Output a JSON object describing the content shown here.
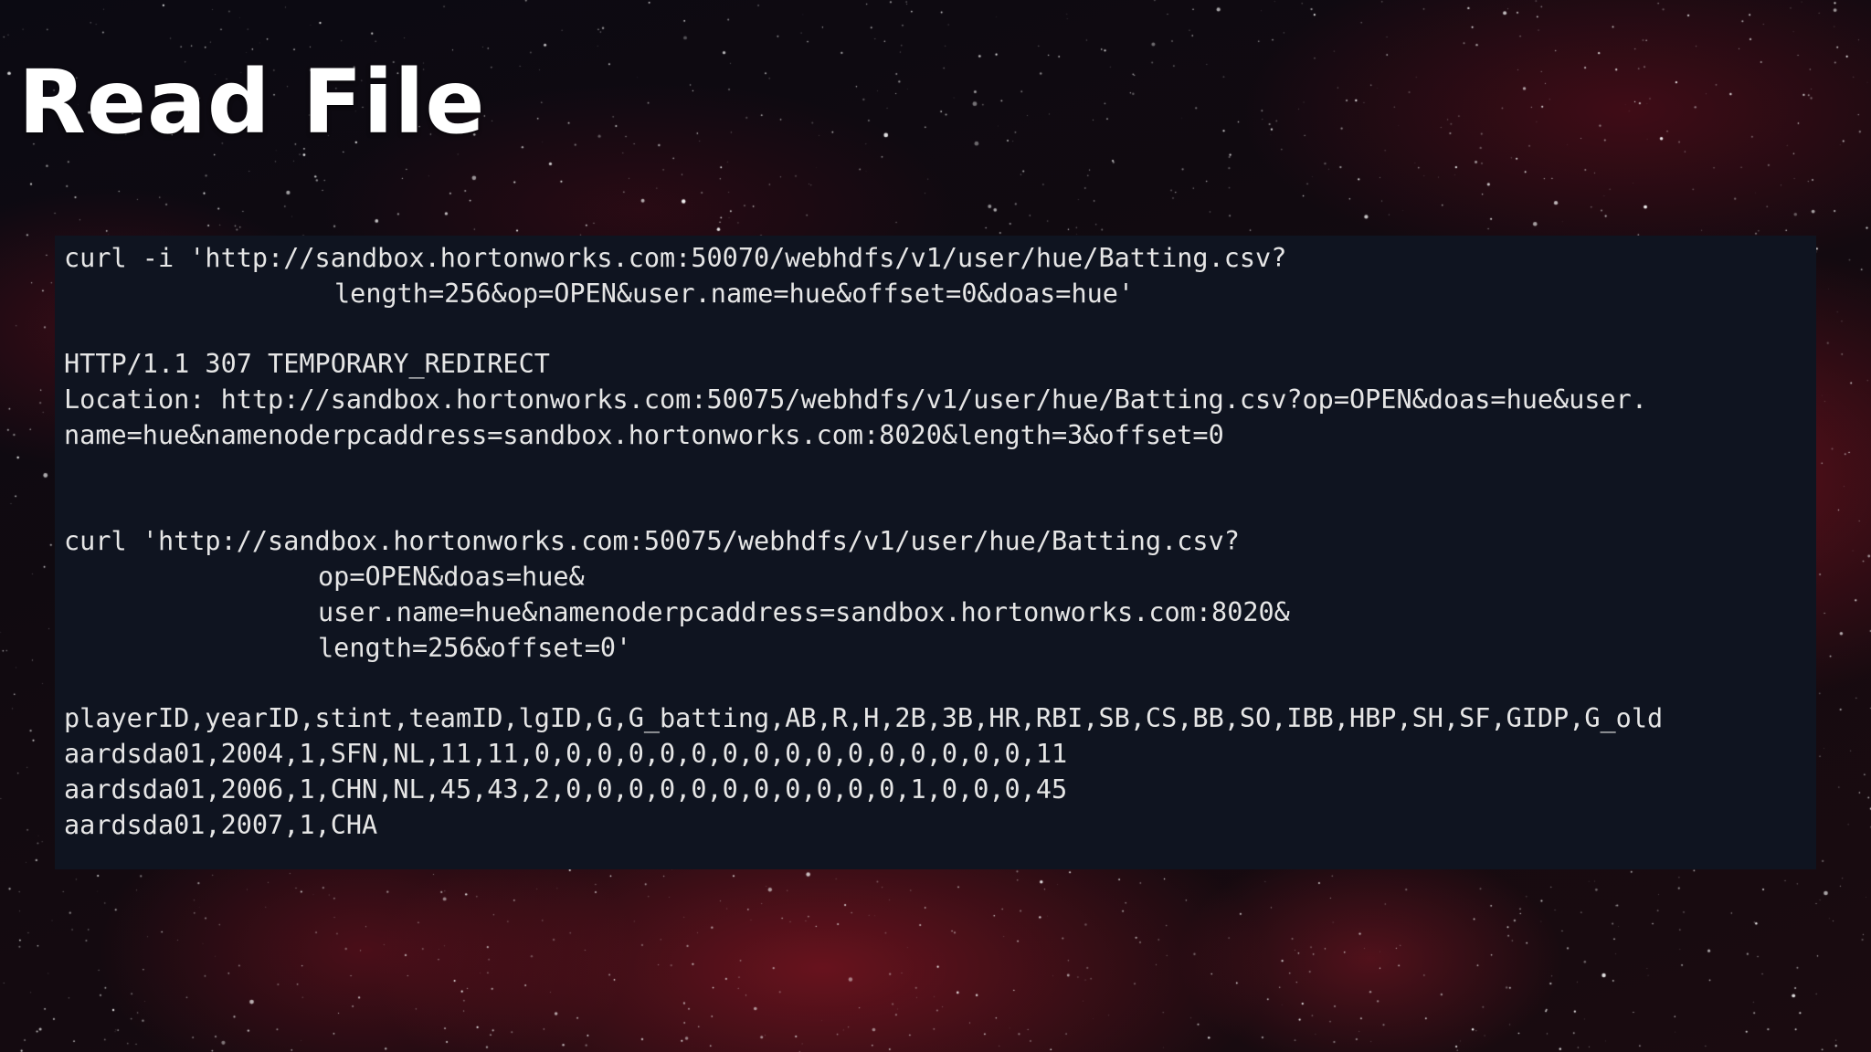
{
  "slide": {
    "title": "Read File"
  },
  "code": {
    "request1_line1": "curl -i 'http://sandbox.hortonworks.com:50070/webhdfs/v1/user/hue/Batting.csv?",
    "request1_line2": "length=256&op=OPEN&user.name=hue&offset=0&doas=hue'",
    "response_status": "HTTP/1.1 307 TEMPORARY_REDIRECT",
    "response_location_line1": "Location: http://sandbox.hortonworks.com:50075/webhdfs/v1/user/hue/Batting.csv?op=OPEN&doas=hue&user.",
    "response_location_line2": "name=hue&namenoderpcaddress=sandbox.hortonworks.com:8020&length=3&offset=0",
    "request2_line1": "curl 'http://sandbox.hortonworks.com:50075/webhdfs/v1/user/hue/Batting.csv?",
    "request2_line2": "op=OPEN&doas=hue&",
    "request2_line3": "user.name=hue&namenoderpcaddress=sandbox.hortonworks.com:8020&",
    "request2_line4": "length=256&offset=0'",
    "csv_header": "playerID,yearID,stint,teamID,lgID,G,G_batting,AB,R,H,2B,3B,HR,RBI,SB,CS,BB,SO,IBB,HBP,SH,SF,GIDP,G_old",
    "csv_row1": "aardsda01,2004,1,SFN,NL,11,11,0,0,0,0,0,0,0,0,0,0,0,0,0,0,0,0,11",
    "csv_row2": "aardsda01,2006,1,CHN,NL,45,43,2,0,0,0,0,0,0,0,0,0,0,0,1,0,0,0,45",
    "csv_row3": "aardsda01,2007,1,CHA"
  },
  "colors": {
    "code_background": "#0f1420",
    "code_text": "#e6e6e6",
    "title_text": "#ffffff",
    "nebula_red": "#a01828"
  }
}
